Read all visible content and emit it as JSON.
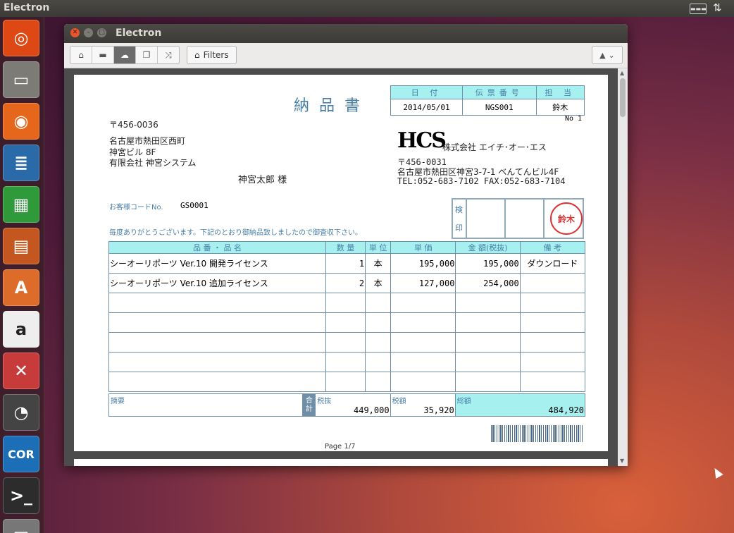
{
  "system": {
    "panel_title": "Electron",
    "keyboard_label": "▬▬▬",
    "network_symbol": "⇅"
  },
  "launcher": [
    {
      "name": "ubuntu",
      "glyph": "◎",
      "color": "#dd4814"
    },
    {
      "name": "files",
      "glyph": "▭",
      "color": "#7d7b76"
    },
    {
      "name": "firefox",
      "glyph": "◉",
      "color": "#e6661b"
    },
    {
      "name": "writer",
      "glyph": "≣",
      "color": "#2a6aa9"
    },
    {
      "name": "calc",
      "glyph": "▦",
      "color": "#2e9a3a"
    },
    {
      "name": "impress",
      "glyph": "▤",
      "color": "#c4571f"
    },
    {
      "name": "software-center",
      "glyph": "A",
      "color": "#dd6b2a"
    },
    {
      "name": "amazon",
      "glyph": "a",
      "color": "#eeeeee"
    },
    {
      "name": "settings",
      "glyph": "✕",
      "color": "#c83b3b"
    },
    {
      "name": "disk",
      "glyph": "◔",
      "color": "#444444"
    },
    {
      "name": "cor",
      "glyph": "COR",
      "color": "#1c6fb7"
    },
    {
      "name": "terminal",
      "glyph": ">_",
      "color": "#2c2c2c"
    },
    {
      "name": "save",
      "glyph": "▣",
      "color": "#777777"
    }
  ],
  "window": {
    "title": "Electron",
    "toolbar": {
      "filters_label": "Filters",
      "speaker_glyph": "▲",
      "buttons": [
        "⌂",
        "▬",
        "☁",
        "❐",
        "⤨"
      ]
    }
  },
  "doc": {
    "title": "納品書",
    "header_cols": [
      "日 付",
      "伝票番号",
      "担 当"
    ],
    "header_vals": [
      "2014/05/01",
      "NGS001",
      "鈴木"
    ],
    "no": "No 1",
    "customer": {
      "zip": "〒456-0036",
      "address1": "名古屋市熱田区西町",
      "address2": "神宮ビル 8F",
      "company": "有限会社 神宮システム",
      "person": "神宮太郎 様",
      "code_label": "お客様コードNo.",
      "code_value": "GS0001",
      "greeting": "毎度ありがとうございます。下記のとおり御納品致しましたので御査収下さい。"
    },
    "issuer": {
      "logo": "HCS",
      "name": "株式会社 エイチ･オー･エス",
      "zip": "〒456-0031",
      "address": "名古屋市熱田区神宮3-7-1 べんてんビル4F",
      "contact": "TEL:052-683-7102 FAX:052-683-7104"
    },
    "stamp": {
      "label_top": "検",
      "label_bottom": "印",
      "seal": "鈴木"
    },
    "table_headers": [
      "品 番 ・ 品 名",
      "数 量",
      "単 位",
      "単 価",
      "金 額(税抜)",
      "備 考"
    ],
    "rows": [
      [
        "シーオーリポーツ Ver.10 開発ライセンス",
        "1",
        "本",
        "195,000",
        "195,000",
        "ダウンロード"
      ],
      [
        "シーオーリポーツ Ver.10 追加ライセンス",
        "2",
        "本",
        "127,000",
        "254,000",
        ""
      ],
      [
        "",
        "",
        "",
        "",
        "",
        ""
      ],
      [
        "",
        "",
        "",
        "",
        "",
        ""
      ],
      [
        "",
        "",
        "",
        "",
        "",
        ""
      ],
      [
        "",
        "",
        "",
        "",
        "",
        ""
      ],
      [
        "",
        "",
        "",
        "",
        "",
        ""
      ]
    ],
    "summary": {
      "memo_label": "摘要",
      "total_label": "合計",
      "pretax_label": "税抜",
      "pretax": "449,000",
      "tax_label": "税額",
      "tax": "35,920",
      "grand_label": "総額",
      "grand": "484,920"
    },
    "page": "Page 1/7"
  }
}
